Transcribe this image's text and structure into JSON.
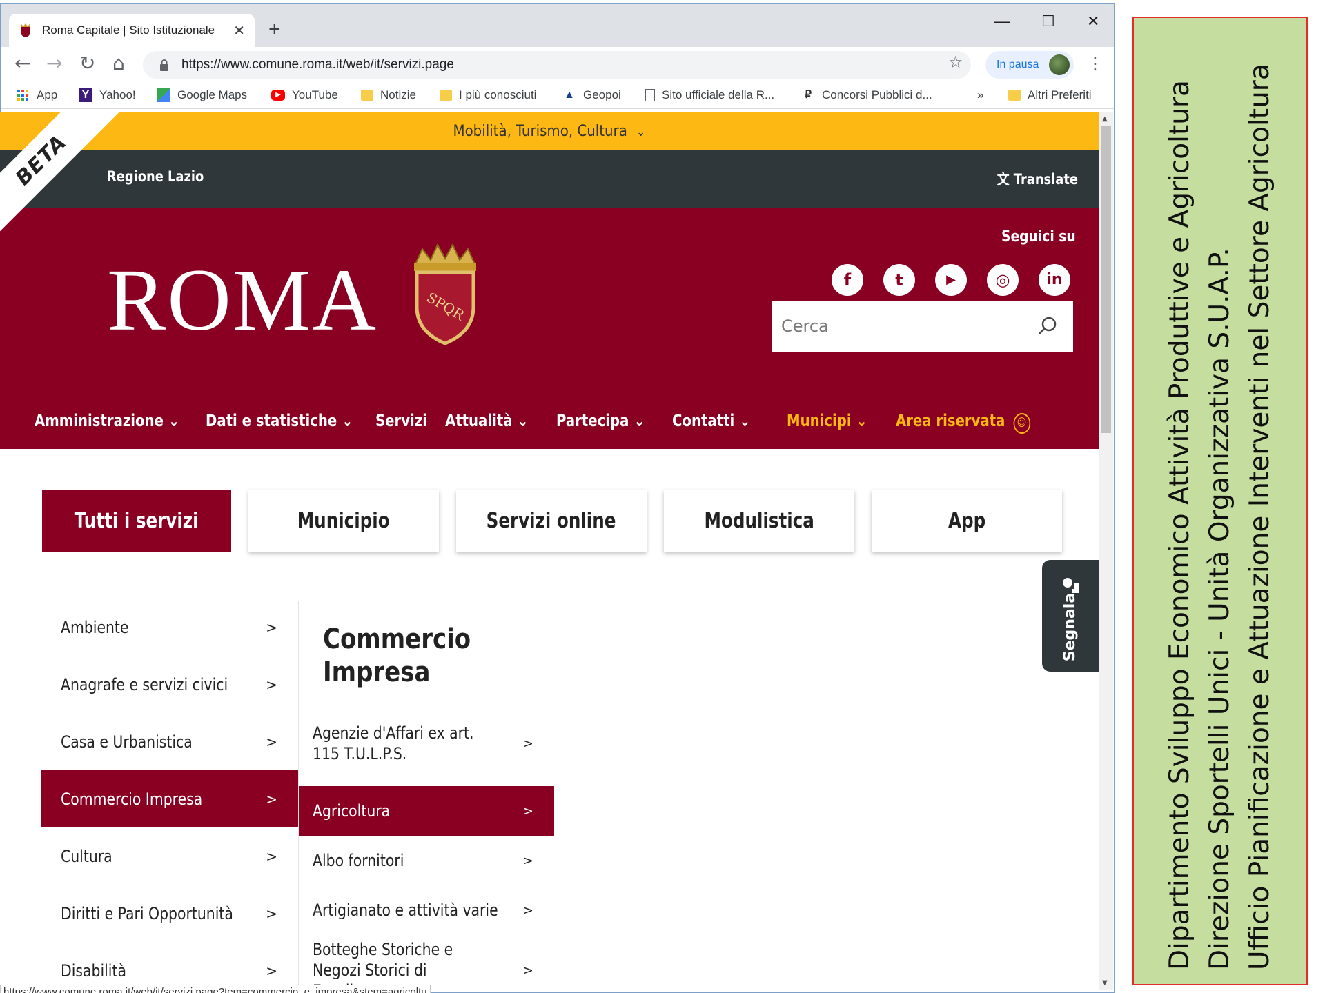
{
  "browser": {
    "tab_title": "Roma Capitale | Sito Istituzionale",
    "tab_close": "✕",
    "new_tab": "+",
    "window_controls": {
      "minimize": "—",
      "maximize": "☐",
      "close": "✕"
    },
    "nav": {
      "back": "←",
      "forward": "→",
      "reload": "↻",
      "home": "⌂"
    },
    "url": "https://www.comune.roma.it/web/it/servizi.page",
    "bookmark_star": "☆",
    "profile_status": "In pausa",
    "menu": "⋮",
    "bookmarks": [
      {
        "label": "App",
        "icon": "apps-grid-icon"
      },
      {
        "label": "Yahoo!",
        "icon": "yahoo-icon"
      },
      {
        "label": "Google Maps",
        "icon": "maps-icon"
      },
      {
        "label": "YouTube",
        "icon": "youtube-icon"
      },
      {
        "label": "Notizie",
        "icon": "folder-icon"
      },
      {
        "label": "I più conosciuti",
        "icon": "folder-icon"
      },
      {
        "label": "Geopoi",
        "icon": "geopoi-icon"
      },
      {
        "label": "Sito ufficiale della R...",
        "icon": "page-icon"
      },
      {
        "label": "Concorsi Pubblici d...",
        "icon": "concorsi-icon"
      }
    ],
    "bookmarks_overflow": "»",
    "other_bookmarks": "Altri Preferiti",
    "status_url": "https://www.comune.roma.it/web/it/servizi.page?tem=commercio_e_impresa&stem=agricoltu"
  },
  "site": {
    "beta": "BETA",
    "util_menu": "Mobilità, Turismo, Cultura",
    "region": "Regione Lazio",
    "translate": "Translate",
    "logo_text": "ROMA",
    "crest_text": "SPQR",
    "follow_label": "Seguici su",
    "social": [
      {
        "name": "facebook",
        "glyph": "f"
      },
      {
        "name": "twitter",
        "glyph": "t"
      },
      {
        "name": "youtube",
        "glyph": "▶"
      },
      {
        "name": "instagram",
        "glyph": "◎"
      },
      {
        "name": "linkedin",
        "glyph": "in"
      }
    ],
    "search_placeholder": "Cerca",
    "main_nav": [
      {
        "label": "Amministrazione",
        "dropdown": true
      },
      {
        "label": "Dati e statistiche",
        "dropdown": true
      },
      {
        "label": "Servizi",
        "dropdown": false
      },
      {
        "label": "Attualità",
        "dropdown": true
      },
      {
        "label": "Partecipa",
        "dropdown": true
      },
      {
        "label": "Contatti",
        "dropdown": true
      },
      {
        "label": "Municipi",
        "dropdown": true
      },
      {
        "label": "Area riservata",
        "dropdown": false
      }
    ],
    "service_tabs": [
      "Tutti i servizi",
      "Municipio",
      "Servizi online",
      "Modulistica",
      "App"
    ],
    "active_service_tab": "Tutti i servizi",
    "segnala": "Segnala",
    "categories": [
      "Ambiente",
      "Anagrafe e servizi civici",
      "Casa e Urbanistica",
      "Commercio Impresa",
      "Cultura",
      "Diritti e Pari Opportunità",
      "Disabilità"
    ],
    "active_category": "Commercio Impresa",
    "arrow": ">",
    "subcategory_title": "Commercio Impresa",
    "subcategories": [
      "Agenzie d'Affari ex art. 115 T.U.L.P.S.",
      "Agricoltura",
      "Albo fornitori",
      "Artigianato e attività varie",
      "Botteghe Storiche e Negozi Storici di Eccellenza"
    ],
    "active_subcategory": "Agricoltura"
  },
  "annotation": {
    "lines": [
      "Dipartimento Sviluppo Economico Attività Produttive e Agricoltura",
      "Direzione  Sportelli Unici - Unità Organizzativa S.U.A.P.",
      "Ufficio Pianificazione e Attuazione  Interventi nel Settore Agricoltura"
    ]
  },
  "colors": {
    "brand_red": "#8a0022",
    "gold": "#fdb813",
    "dark_bar": "#30373b",
    "annotation_bg": "#c5dd9e",
    "annotation_border": "#e52a2a"
  }
}
